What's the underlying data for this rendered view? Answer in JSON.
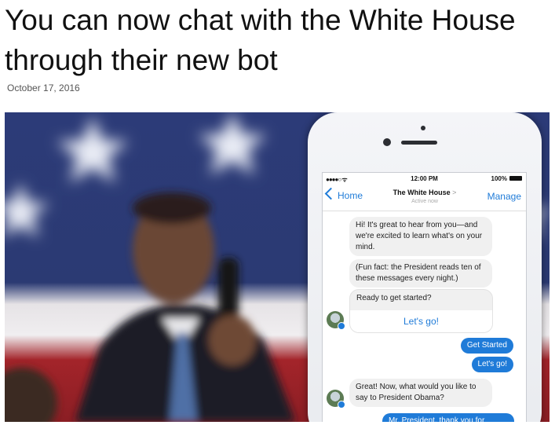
{
  "article": {
    "headline": "You can now chat with the White House through their new bot",
    "date": "October 17, 2016"
  },
  "phone": {
    "status": {
      "signal": "●●●●○ ᯤ",
      "time": "12:00 PM",
      "battery": "100%"
    },
    "nav": {
      "back_label": "Home",
      "title": "The White House",
      "title_chevron": ">",
      "subtitle": "Active now",
      "manage_label": "Manage"
    },
    "messages": [
      "Hi! It's great to hear from you—and we're excited to learn what's on your mind.",
      "(Fun fact: the President reads ten of these messages every night.)",
      "Ready to get started?",
      "Great! Now, what would you like to say to President Obama?"
    ],
    "card_button": "Let's go!",
    "replies": [
      "Get Started",
      "Let's go!",
      "Mr. President, thank you for"
    ]
  },
  "colors": {
    "accent": "#1f7bd8",
    "flag_blue": "#27356b",
    "flag_red": "#a3242a"
  }
}
